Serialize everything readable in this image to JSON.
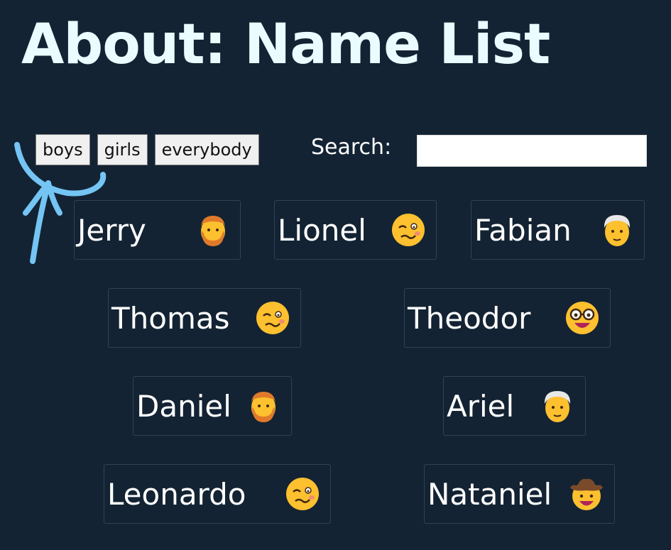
{
  "page": {
    "title": "About: Name List"
  },
  "filters": [
    {
      "label": "boys"
    },
    {
      "label": "girls"
    },
    {
      "label": "everybody"
    }
  ],
  "search": {
    "label": "Search:",
    "value": ""
  },
  "names": [
    {
      "name": "Jerry",
      "emoji": "man-red-hair-beard-emoji"
    },
    {
      "name": "Lionel",
      "emoji": "woozy-face-emoji"
    },
    {
      "name": "Fabian",
      "emoji": "old-man-emoji"
    },
    {
      "name": "Thomas",
      "emoji": "woozy-face-emoji"
    },
    {
      "name": "Theodor",
      "emoji": "nerd-face-emoji"
    },
    {
      "name": "Daniel",
      "emoji": "man-red-hair-beard-emoji"
    },
    {
      "name": "Ariel",
      "emoji": "old-man-emoji"
    },
    {
      "name": "Leonardo",
      "emoji": "woozy-face-emoji"
    },
    {
      "name": "Nataniel",
      "emoji": "cowboy-face-emoji"
    }
  ],
  "colors": {
    "background": "#132333",
    "title": "#eafcff",
    "arrow": "#74c5f4",
    "emoji_yellow": "#fdc02f"
  }
}
